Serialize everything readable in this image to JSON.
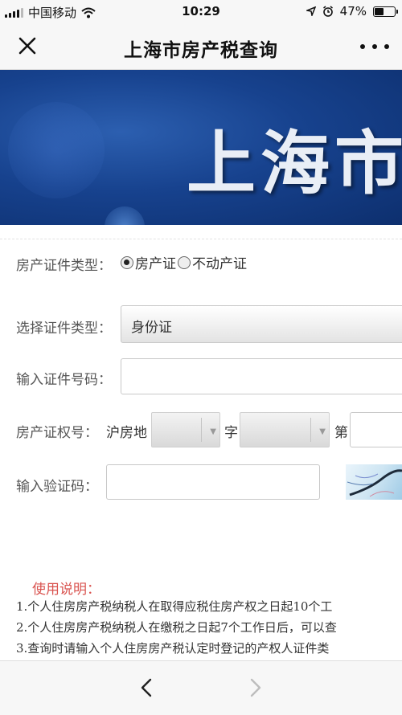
{
  "status_bar": {
    "carrier": "中国移动",
    "time": "10:29",
    "battery_text": "47%",
    "battery_level": 0.47,
    "icons": [
      "signal-icon",
      "wifi-icon",
      "location-icon",
      "alarm-icon",
      "battery-icon"
    ]
  },
  "nav": {
    "title": "上海市房产税查询",
    "close_icon": "close-icon",
    "more_icon": "more-icon"
  },
  "banner": {
    "text": "上海市房"
  },
  "form": {
    "cert_type_label": "房产证件类型：",
    "radio_options": [
      {
        "label": "房产证",
        "checked": true
      },
      {
        "label": "不动产证",
        "checked": false
      }
    ],
    "id_type_label": "选择证件类型：",
    "id_type_value": "身份证",
    "id_number_label": "输入证件号码：",
    "id_number_value": "",
    "property_no_label": "房产证权号：",
    "prefix_text": "沪房地",
    "char_zi": "字",
    "char_di": "第",
    "captcha_label": "输入验证码：",
    "captcha_value": ""
  },
  "instructions": {
    "title": "使用说明：",
    "items": [
      "1.个人住房房产税纳税人在取得应税住房产权之日起10个工",
      "2.个人住房房产税纳税人在缴税之日起7个工作日后，可以查",
      "3.查询时请输入个人住房房产税认定时登记的产权人证件类"
    ]
  },
  "toolbar": {
    "back_icon": "chevron-left-icon",
    "forward_icon": "chevron-right-icon"
  },
  "colors": {
    "accent_red": "#d9534f",
    "banner_blue": "#17428e"
  }
}
